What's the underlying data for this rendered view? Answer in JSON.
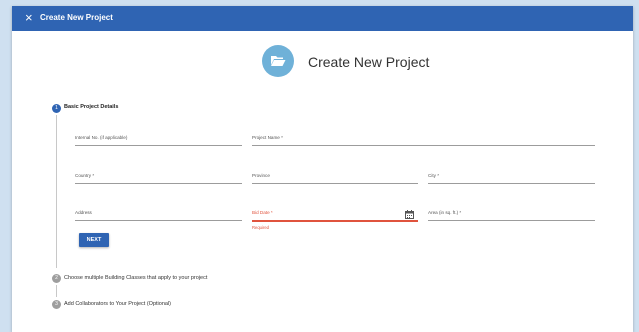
{
  "window": {
    "title": "Create New Project",
    "close_glyph": "×"
  },
  "header": {
    "icon": "folder-open-icon",
    "title": "Create New Project"
  },
  "steps": [
    {
      "number": "1",
      "label": "Basic Project Details",
      "state": "active"
    },
    {
      "number": "2",
      "label": "Choose multiple Building Classes that apply to your project",
      "state": "inactive"
    },
    {
      "number": "3",
      "label": "Add Collaborators to Your Project (Optional)",
      "state": "inactive"
    }
  ],
  "form": {
    "internal_no": {
      "label": "Internal No. (if applicable)",
      "value": ""
    },
    "project_name": {
      "label": "Project Name *",
      "value": ""
    },
    "country": {
      "label": "Country *",
      "value": ""
    },
    "province": {
      "label": "Province",
      "value": ""
    },
    "city": {
      "label": "City *",
      "value": ""
    },
    "address": {
      "label": "Address",
      "value": ""
    },
    "bid_date": {
      "label": "Bid Date *",
      "value": "",
      "error": "Required",
      "icon": "calendar-icon"
    },
    "area": {
      "label": "Area (in sq. ft.) *",
      "value": ""
    }
  },
  "next_button": {
    "label": "NEXT"
  },
  "colors": {
    "primary": "#2f64b3",
    "header_icon_bg": "#6fb1d8",
    "error": "#e0533d",
    "page_bg": "#cfe0f0"
  }
}
